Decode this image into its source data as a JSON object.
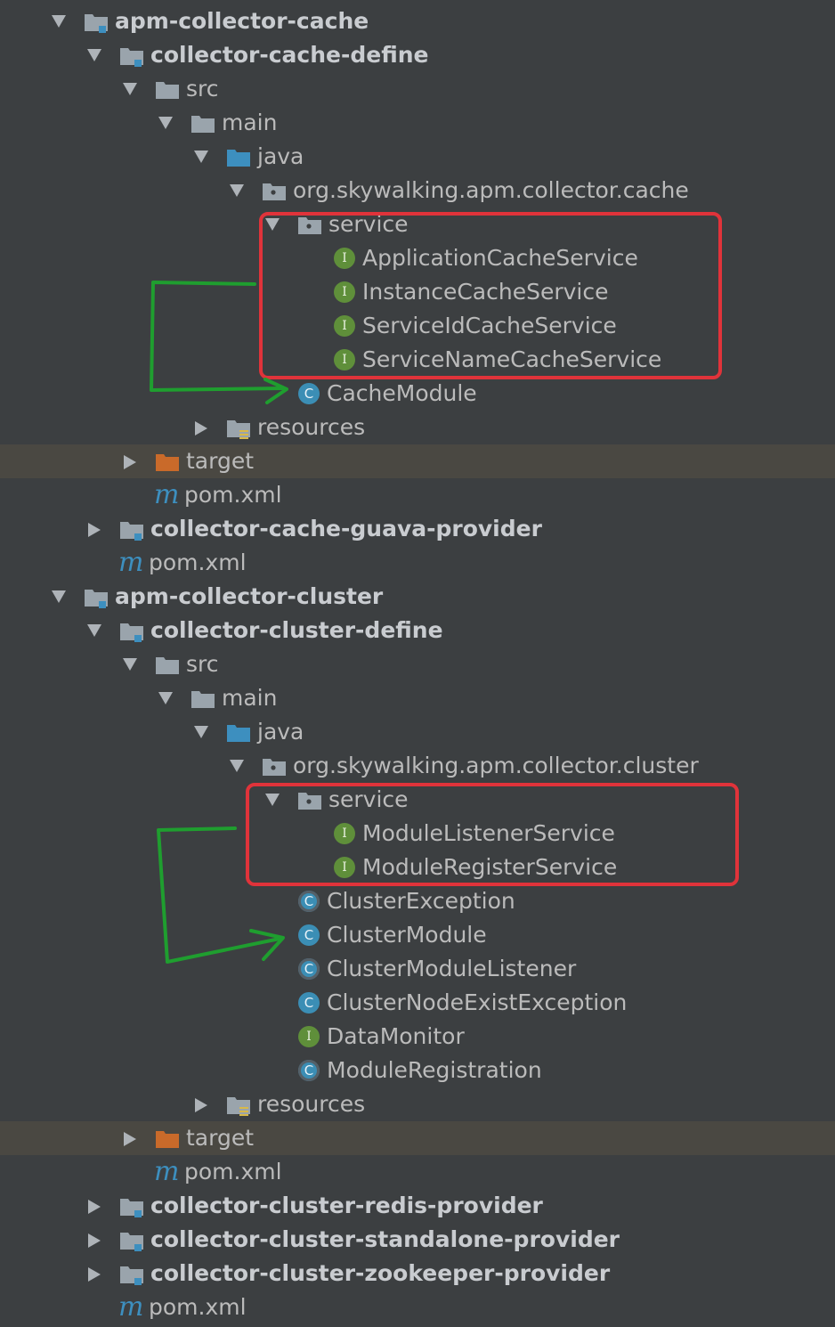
{
  "colors": {
    "folder": "#9aa4ac",
    "source_folder": "#3d8fbf",
    "target_folder": "#c96a2a",
    "module_marker": "#3d8fbf",
    "highlight_box": "#e0333a",
    "arrow": "#1f9e2f"
  },
  "tree": [
    {
      "label": "apm-collector-cache",
      "kind": "module",
      "level": 0,
      "state": "expanded",
      "bold": true,
      "icon": "module-folder-icon"
    },
    {
      "label": "collector-cache-define",
      "kind": "module",
      "level": 1,
      "state": "expanded",
      "bold": true,
      "icon": "module-folder-icon"
    },
    {
      "label": "src",
      "kind": "folder",
      "level": 2,
      "state": "expanded",
      "icon": "folder-icon"
    },
    {
      "label": "main",
      "kind": "folder",
      "level": 3,
      "state": "expanded",
      "icon": "folder-icon"
    },
    {
      "label": "java",
      "kind": "source",
      "level": 4,
      "state": "expanded",
      "icon": "source-folder-icon"
    },
    {
      "label": "org.skywalking.apm.collector.cache",
      "kind": "package",
      "level": 5,
      "state": "expanded",
      "icon": "package-icon"
    },
    {
      "label": "service",
      "kind": "package",
      "level": 6,
      "state": "expanded",
      "icon": "package-icon"
    },
    {
      "label": "ApplicationCacheService",
      "kind": "interface",
      "level": 7,
      "icon": "interface-icon"
    },
    {
      "label": "InstanceCacheService",
      "kind": "interface",
      "level": 7,
      "icon": "interface-icon"
    },
    {
      "label": "ServiceIdCacheService",
      "kind": "interface",
      "level": 7,
      "icon": "interface-icon"
    },
    {
      "label": "ServiceNameCacheService",
      "kind": "interface",
      "level": 7,
      "icon": "interface-icon"
    },
    {
      "label": "CacheModule",
      "kind": "class",
      "level": 6,
      "icon": "class-icon"
    },
    {
      "label": "resources",
      "kind": "resources",
      "level": 4,
      "state": "collapsed",
      "icon": "resources-folder-icon"
    },
    {
      "label": "target",
      "kind": "target",
      "level": 2,
      "state": "collapsed",
      "icon": "target-folder-icon",
      "highlight": true
    },
    {
      "label": "pom.xml",
      "kind": "maven",
      "level": 2,
      "icon": "maven-icon"
    },
    {
      "label": "collector-cache-guava-provider",
      "kind": "module",
      "level": 1,
      "state": "collapsed",
      "bold": true,
      "icon": "module-folder-icon"
    },
    {
      "label": "pom.xml",
      "kind": "maven",
      "level": 1,
      "icon": "maven-icon"
    },
    {
      "label": "apm-collector-cluster",
      "kind": "module",
      "level": 0,
      "state": "expanded",
      "bold": true,
      "icon": "module-folder-icon"
    },
    {
      "label": "collector-cluster-define",
      "kind": "module",
      "level": 1,
      "state": "expanded",
      "bold": true,
      "icon": "module-folder-icon"
    },
    {
      "label": "src",
      "kind": "folder",
      "level": 2,
      "state": "expanded",
      "icon": "folder-icon"
    },
    {
      "label": "main",
      "kind": "folder",
      "level": 3,
      "state": "expanded",
      "icon": "folder-icon"
    },
    {
      "label": "java",
      "kind": "source",
      "level": 4,
      "state": "expanded",
      "icon": "source-folder-icon"
    },
    {
      "label": "org.skywalking.apm.collector.cluster",
      "kind": "package",
      "level": 5,
      "state": "expanded",
      "icon": "package-icon"
    },
    {
      "label": "service",
      "kind": "package",
      "level": 6,
      "state": "expanded",
      "icon": "package-icon"
    },
    {
      "label": "ModuleListenerService",
      "kind": "interface",
      "level": 7,
      "icon": "interface-icon"
    },
    {
      "label": "ModuleRegisterService",
      "kind": "interface",
      "level": 7,
      "icon": "interface-icon"
    },
    {
      "label": "ClusterException",
      "kind": "abstract",
      "level": 6,
      "icon": "abstract-class-icon"
    },
    {
      "label": "ClusterModule",
      "kind": "class",
      "level": 6,
      "icon": "class-icon"
    },
    {
      "label": "ClusterModuleListener",
      "kind": "abstract",
      "level": 6,
      "icon": "abstract-class-icon"
    },
    {
      "label": "ClusterNodeExistException",
      "kind": "class",
      "level": 6,
      "icon": "class-icon"
    },
    {
      "label": "DataMonitor",
      "kind": "interface",
      "level": 6,
      "icon": "interface-icon"
    },
    {
      "label": "ModuleRegistration",
      "kind": "abstract",
      "level": 6,
      "icon": "abstract-class-icon"
    },
    {
      "label": "resources",
      "kind": "resources",
      "level": 4,
      "state": "collapsed",
      "icon": "resources-folder-icon"
    },
    {
      "label": "target",
      "kind": "target",
      "level": 2,
      "state": "collapsed",
      "icon": "target-folder-icon",
      "highlight": true
    },
    {
      "label": "pom.xml",
      "kind": "maven",
      "level": 2,
      "icon": "maven-icon"
    },
    {
      "label": "collector-cluster-redis-provider",
      "kind": "module",
      "level": 1,
      "state": "collapsed",
      "bold": true,
      "icon": "module-folder-icon"
    },
    {
      "label": "collector-cluster-standalone-provider",
      "kind": "module",
      "level": 1,
      "state": "collapsed",
      "bold": true,
      "icon": "module-folder-icon"
    },
    {
      "label": "collector-cluster-zookeeper-provider",
      "kind": "module",
      "level": 1,
      "state": "collapsed",
      "bold": true,
      "icon": "module-folder-icon"
    },
    {
      "label": "pom.xml",
      "kind": "maven",
      "level": 1,
      "icon": "maven-icon"
    }
  ],
  "glyphs": {
    "class": "C",
    "interface": "I",
    "maven": "m"
  }
}
